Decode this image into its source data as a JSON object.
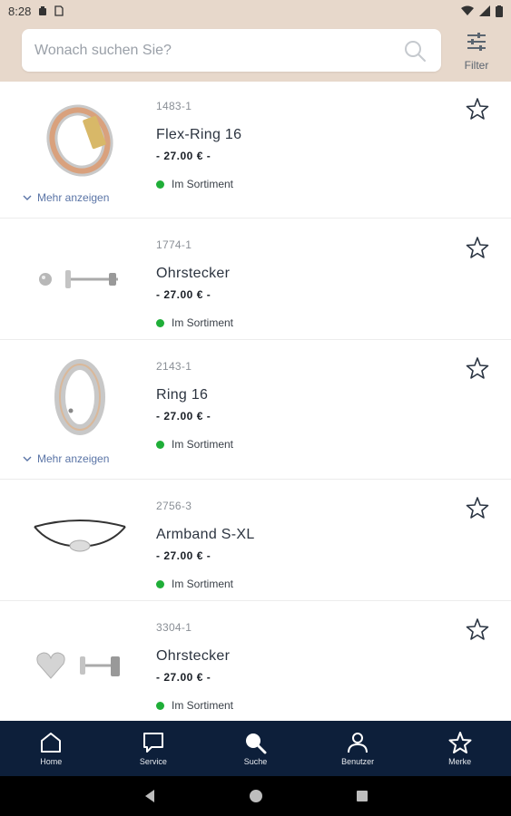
{
  "status_bar": {
    "time": "8:28"
  },
  "search": {
    "placeholder": "Wonach suchen Sie?"
  },
  "filter_label": "Filter",
  "more_label": "Mehr anzeigen",
  "availability_color": "#1fae38",
  "nav_bg_color": "#0d1f3a",
  "header_bg_color": "#e7d8cb",
  "products": [
    {
      "sku": "1483-1",
      "name": "Flex-Ring 16",
      "price": "- 27.00 € -",
      "availability": "Im Sortiment",
      "has_more": true,
      "image": "ring-flex"
    },
    {
      "sku": "1774-1",
      "name": "Ohrstecker",
      "price": "- 27.00 € -",
      "availability": "Im Sortiment",
      "has_more": false,
      "image": "earstud-ball"
    },
    {
      "sku": "2143-1",
      "name": "Ring 16",
      "price": "- 27.00 € -",
      "availability": "Im Sortiment",
      "has_more": true,
      "image": "ring-silver"
    },
    {
      "sku": "2756-3",
      "name": "Armband S-XL",
      "price": "- 27.00 € -",
      "availability": "Im Sortiment",
      "has_more": false,
      "image": "bracelet"
    },
    {
      "sku": "3304-1",
      "name": "Ohrstecker",
      "price": "- 27.00 € -",
      "availability": "Im Sortiment",
      "has_more": false,
      "image": "earstud-heart"
    }
  ],
  "bottom_nav": [
    {
      "label": "Home",
      "icon": "home-icon",
      "active": false
    },
    {
      "label": "Service",
      "icon": "chat-icon",
      "active": false
    },
    {
      "label": "Suche",
      "icon": "search-icon",
      "active": true
    },
    {
      "label": "Benutzer",
      "icon": "user-icon",
      "active": false
    },
    {
      "label": "Merke",
      "icon": "star-icon",
      "active": false
    }
  ]
}
